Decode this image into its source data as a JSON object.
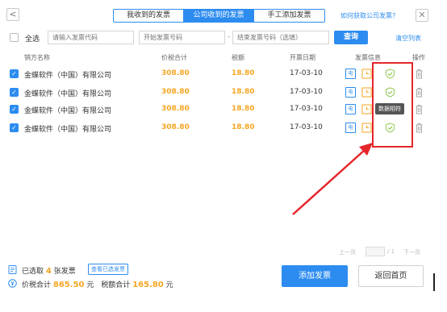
{
  "header": {
    "back_glyph": "<",
    "tabs": [
      {
        "label": "我收到的发票",
        "active": false
      },
      {
        "label": "公司收到的发票",
        "active": true
      },
      {
        "label": "手工添加发票",
        "active": false
      }
    ],
    "help_link": "如何获取公司发票?",
    "close_glyph": "✕"
  },
  "filters": {
    "select_all_label": "全选",
    "select_all_checked": false,
    "invoice_code_placeholder": "请输入发票代码",
    "start_number_placeholder": "开始发票号码",
    "range_separator": "-",
    "end_number_placeholder": "结束发票号码（选填）",
    "query_button": "查询",
    "clear_link": "清空列表"
  },
  "table": {
    "headers": [
      "销方名称",
      "价税合计",
      "税额",
      "开票日期",
      "发票信息",
      "操作"
    ],
    "rows": [
      {
        "checked": true,
        "seller": "金蝶软件（中国）有限公司",
        "total": "308.80",
        "tax": "18.80",
        "date": "17-03-10"
      },
      {
        "checked": true,
        "seller": "金蝶软件（中国）有限公司",
        "total": "308.80",
        "tax": "18.80",
        "date": "17-03-10"
      },
      {
        "checked": true,
        "seller": "金蝶软件（中国）有限公司",
        "total": "308.80",
        "tax": "18.80",
        "date": "17-03-10"
      },
      {
        "checked": true,
        "seller": "金蝶软件（中国）有限公司",
        "total": "308.80",
        "tax": "18.80",
        "date": "17-03-10"
      }
    ],
    "action_icons": [
      "e-invoice-icon",
      "clock-icon",
      "shield-check-icon",
      "trash-icon"
    ],
    "e_icon_glyph": "电",
    "tooltip": "数据相符"
  },
  "pagination": {
    "prev": "上一页",
    "current": "",
    "total": "/ 1",
    "next": "下一页"
  },
  "footer": {
    "selected_prefix": "已选取",
    "selected_count": "4",
    "selected_suffix": "张发票",
    "view_selected": "查看已选发票",
    "total_label": "价税合计",
    "total_amount": "865.50",
    "total_unit": "元",
    "tax_label": "税额合计",
    "tax_amount": "165.80",
    "tax_unit": "元",
    "add_button": "添加发票",
    "home_button": "返回首页"
  },
  "colors": {
    "accent": "#2d8cf0",
    "amount": "#f5a623",
    "highlight": "#e5262b",
    "shield": "#8bc34a"
  }
}
